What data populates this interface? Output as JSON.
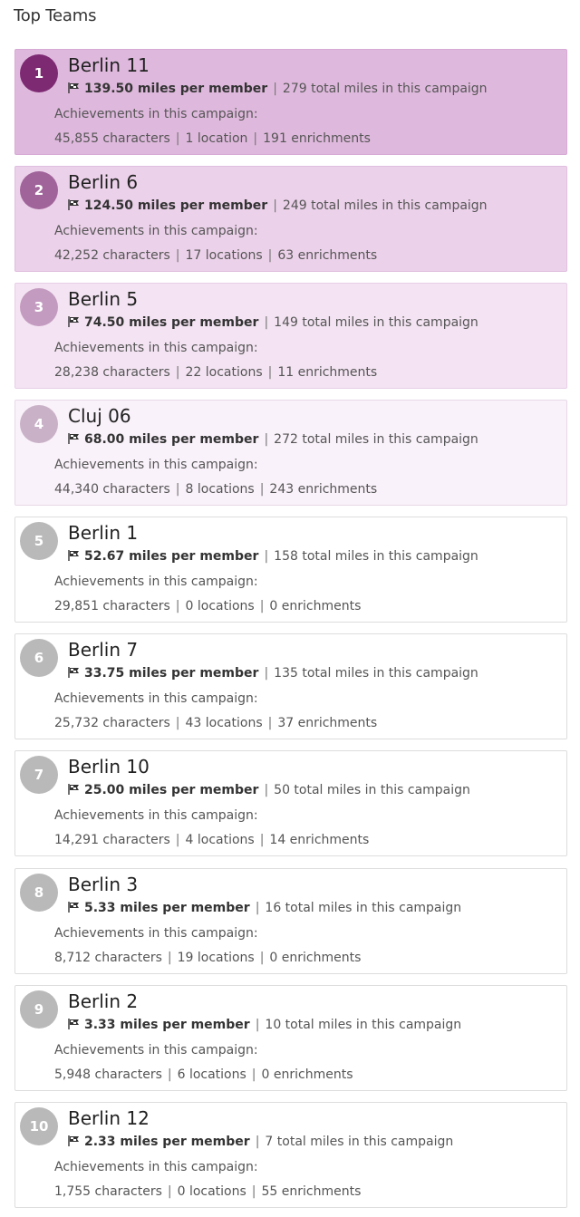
{
  "page": {
    "title": "Top Teams"
  },
  "colors": {
    "rank1": "#7d2a72",
    "rank2": "#a0649a",
    "rank3": "#c49bc0",
    "rank4": "#c9b2c7",
    "rank_other": "#b9b9b9"
  },
  "teams": [
    {
      "rank": "1",
      "name": "Berlin 11",
      "miles_per_member": "139.50 miles per member",
      "total_miles": "279 total miles in this campaign",
      "achievements_label": "Achievements in this campaign:",
      "characters": "45,855 characters",
      "locations": "1 location",
      "enrichments": "191 enrichments"
    },
    {
      "rank": "2",
      "name": "Berlin 6",
      "miles_per_member": "124.50 miles per member",
      "total_miles": "249 total miles in this campaign",
      "achievements_label": "Achievements in this campaign:",
      "characters": "42,252 characters",
      "locations": "17 locations",
      "enrichments": "63 enrichments"
    },
    {
      "rank": "3",
      "name": "Berlin 5",
      "miles_per_member": "74.50 miles per member",
      "total_miles": "149 total miles in this campaign",
      "achievements_label": "Achievements in this campaign:",
      "characters": "28,238 characters",
      "locations": "22 locations",
      "enrichments": "11 enrichments"
    },
    {
      "rank": "4",
      "name": "Cluj 06",
      "miles_per_member": "68.00 miles per member",
      "total_miles": "272 total miles in this campaign",
      "achievements_label": "Achievements in this campaign:",
      "characters": "44,340 characters",
      "locations": "8 locations",
      "enrichments": "243 enrichments"
    },
    {
      "rank": "5",
      "name": "Berlin 1",
      "miles_per_member": "52.67 miles per member",
      "total_miles": "158 total miles in this campaign",
      "achievements_label": "Achievements in this campaign:",
      "characters": "29,851 characters",
      "locations": "0 locations",
      "enrichments": "0 enrichments"
    },
    {
      "rank": "6",
      "name": "Berlin 7",
      "miles_per_member": "33.75 miles per member",
      "total_miles": "135 total miles in this campaign",
      "achievements_label": "Achievements in this campaign:",
      "characters": "25,732 characters",
      "locations": "43 locations",
      "enrichments": "37 enrichments"
    },
    {
      "rank": "7",
      "name": "Berlin 10",
      "miles_per_member": "25.00 miles per member",
      "total_miles": "50 total miles in this campaign",
      "achievements_label": "Achievements in this campaign:",
      "characters": "14,291 characters",
      "locations": "4 locations",
      "enrichments": "14 enrichments"
    },
    {
      "rank": "8",
      "name": "Berlin 3",
      "miles_per_member": "5.33 miles per member",
      "total_miles": "16 total miles in this campaign",
      "achievements_label": "Achievements in this campaign:",
      "characters": "8,712 characters",
      "locations": "19 locations",
      "enrichments": "0 enrichments"
    },
    {
      "rank": "9",
      "name": "Berlin 2",
      "miles_per_member": "3.33 miles per member",
      "total_miles": "10 total miles in this campaign",
      "achievements_label": "Achievements in this campaign:",
      "characters": "5,948 characters",
      "locations": "6 locations",
      "enrichments": "0 enrichments"
    },
    {
      "rank": "10",
      "name": "Berlin 12",
      "miles_per_member": "2.33 miles per member",
      "total_miles": "7 total miles in this campaign",
      "achievements_label": "Achievements in this campaign:",
      "characters": "1,755 characters",
      "locations": "0 locations",
      "enrichments": "55 enrichments"
    }
  ]
}
